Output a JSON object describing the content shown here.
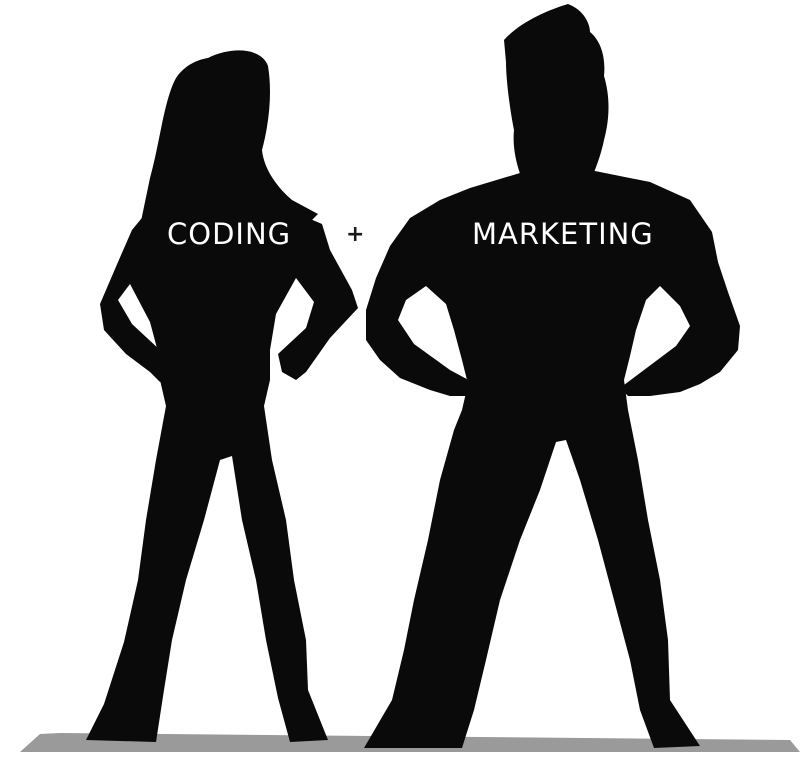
{
  "labels": {
    "left": "CODING",
    "plus": "+",
    "right": "MARKETING"
  },
  "colors": {
    "background": "#ffffff",
    "silhouette": "#0a0a0a",
    "shadow": "#9a9a9a",
    "label_text": "#ffffff",
    "plus_text": "#1a1a1a"
  }
}
